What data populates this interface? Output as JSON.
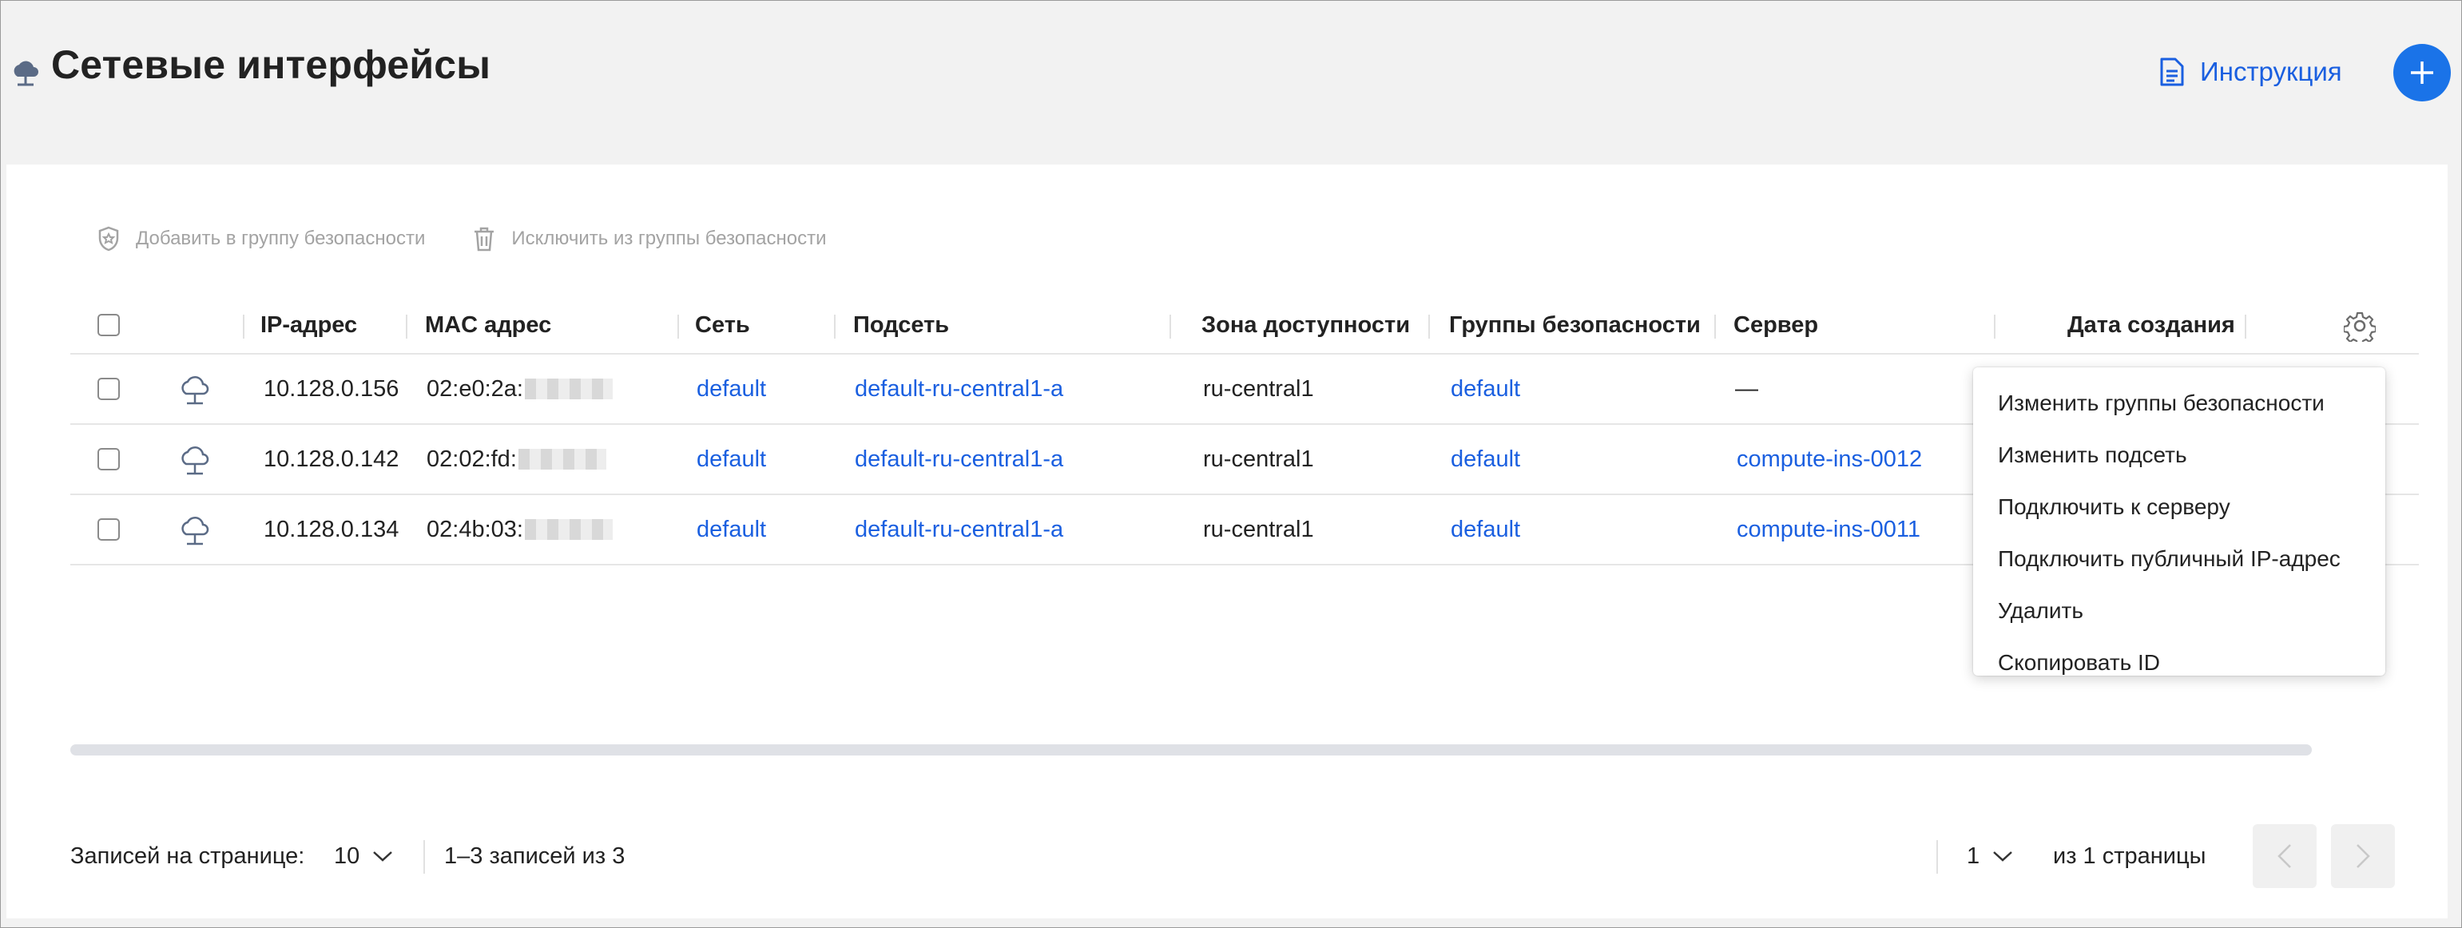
{
  "header": {
    "title": "Сетевые интерфейсы",
    "icon": "cloud-icon",
    "instructions_label": "Инструкция",
    "add_icon": "plus-icon"
  },
  "toolbar": {
    "add_to_group": "Добавить в группу безопасности",
    "remove_from_group": "Исключить из группы безопасности"
  },
  "table": {
    "columns": {
      "ip": "IP-адрес",
      "mac": "MAC адрес",
      "network": "Сеть",
      "subnet": "Подсеть",
      "zone": "Зона доступности",
      "groups": "Группы безопасности",
      "server": "Сервер",
      "created": "Дата создания"
    },
    "rows": [
      {
        "ip": "10.128.0.156",
        "mac": "02:e0:2a:",
        "network": "default",
        "subnet": "default-ru-central1-a",
        "zone": "ru-central1",
        "groups": "default",
        "server": "—"
      },
      {
        "ip": "10.128.0.142",
        "mac": "02:02:fd:",
        "network": "default",
        "subnet": "default-ru-central1-a",
        "zone": "ru-central1",
        "groups": "default",
        "server": "compute-ins-0012"
      },
      {
        "ip": "10.128.0.134",
        "mac": "02:4b:03:",
        "network": "default",
        "subnet": "default-ru-central1-a",
        "zone": "ru-central1",
        "groups": "default",
        "server": "compute-ins-0011"
      }
    ]
  },
  "context_menu": {
    "items": [
      "Изменить группы безопасности",
      "Изменить подсеть",
      "Подключить к серверу",
      "Подключить публичный IP-адрес",
      "Удалить",
      "Скопировать ID"
    ]
  },
  "footer": {
    "per_page_label": "Записей на странице:",
    "per_page_value": "10",
    "range_text": "1–3 записей из 3",
    "page_value": "1",
    "pages_text": "из 1 страницы"
  },
  "colors": {
    "accent": "#1a73e8",
    "link": "#1a5fe0",
    "disabled": "#a3a3a3"
  }
}
